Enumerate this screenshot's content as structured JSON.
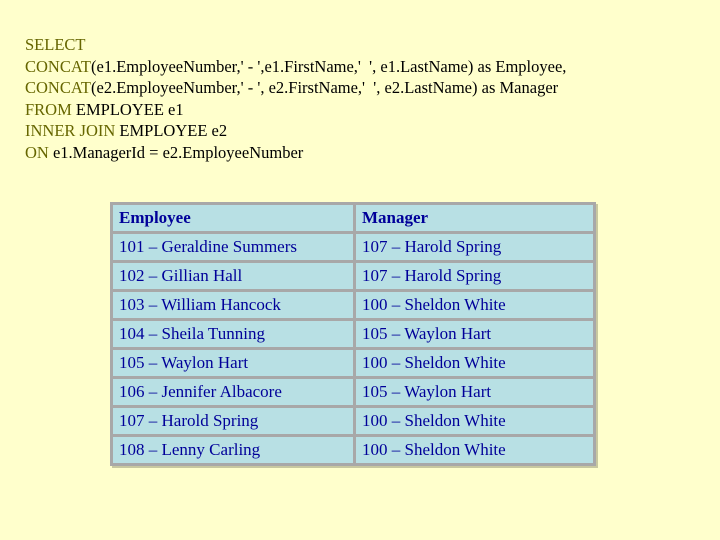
{
  "sql": {
    "lines": [
      {
        "keyword": "SELECT",
        "rest": ""
      },
      {
        "keyword": "CONCAT",
        "rest": "(e1.EmployeeNumber,' - ',e1.FirstName,'  ', e1.LastName) as Employee,"
      },
      {
        "keyword": "CONCAT",
        "rest": "(e2.EmployeeNumber,' - ', e2.FirstName,'  ', e2.LastName) as Manager"
      },
      {
        "keyword": "FROM",
        "rest": " EMPLOYEE e1"
      },
      {
        "keyword": "INNER JOIN",
        "rest": " EMPLOYEE e2"
      },
      {
        "keyword": "ON",
        "rest": " e1.ManagerId = e2.EmployeeNumber"
      }
    ]
  },
  "table": {
    "headers": [
      "Employee",
      "Manager"
    ],
    "rows": [
      [
        "101 – Geraldine Summers",
        "107 – Harold Spring"
      ],
      [
        "102 – Gillian Hall",
        "107 – Harold Spring"
      ],
      [
        "103 – William Hancock",
        "100 – Sheldon White"
      ],
      [
        "104 – Sheila Tunning",
        "105 – Waylon Hart"
      ],
      [
        "105 – Waylon Hart",
        "100 – Sheldon White"
      ],
      [
        "106 – Jennifer Albacore",
        "105 – Waylon Hart"
      ],
      [
        "107 – Harold Spring",
        "100 – Sheldon White"
      ],
      [
        "108 – Lenny Carling",
        "100 – Sheldon White"
      ]
    ]
  },
  "colors": {
    "background": "#ffffcc",
    "keyword": "#666600",
    "table_cell": "#b8e0e4",
    "table_text": "#000099",
    "table_border": "#a8a8a8"
  }
}
